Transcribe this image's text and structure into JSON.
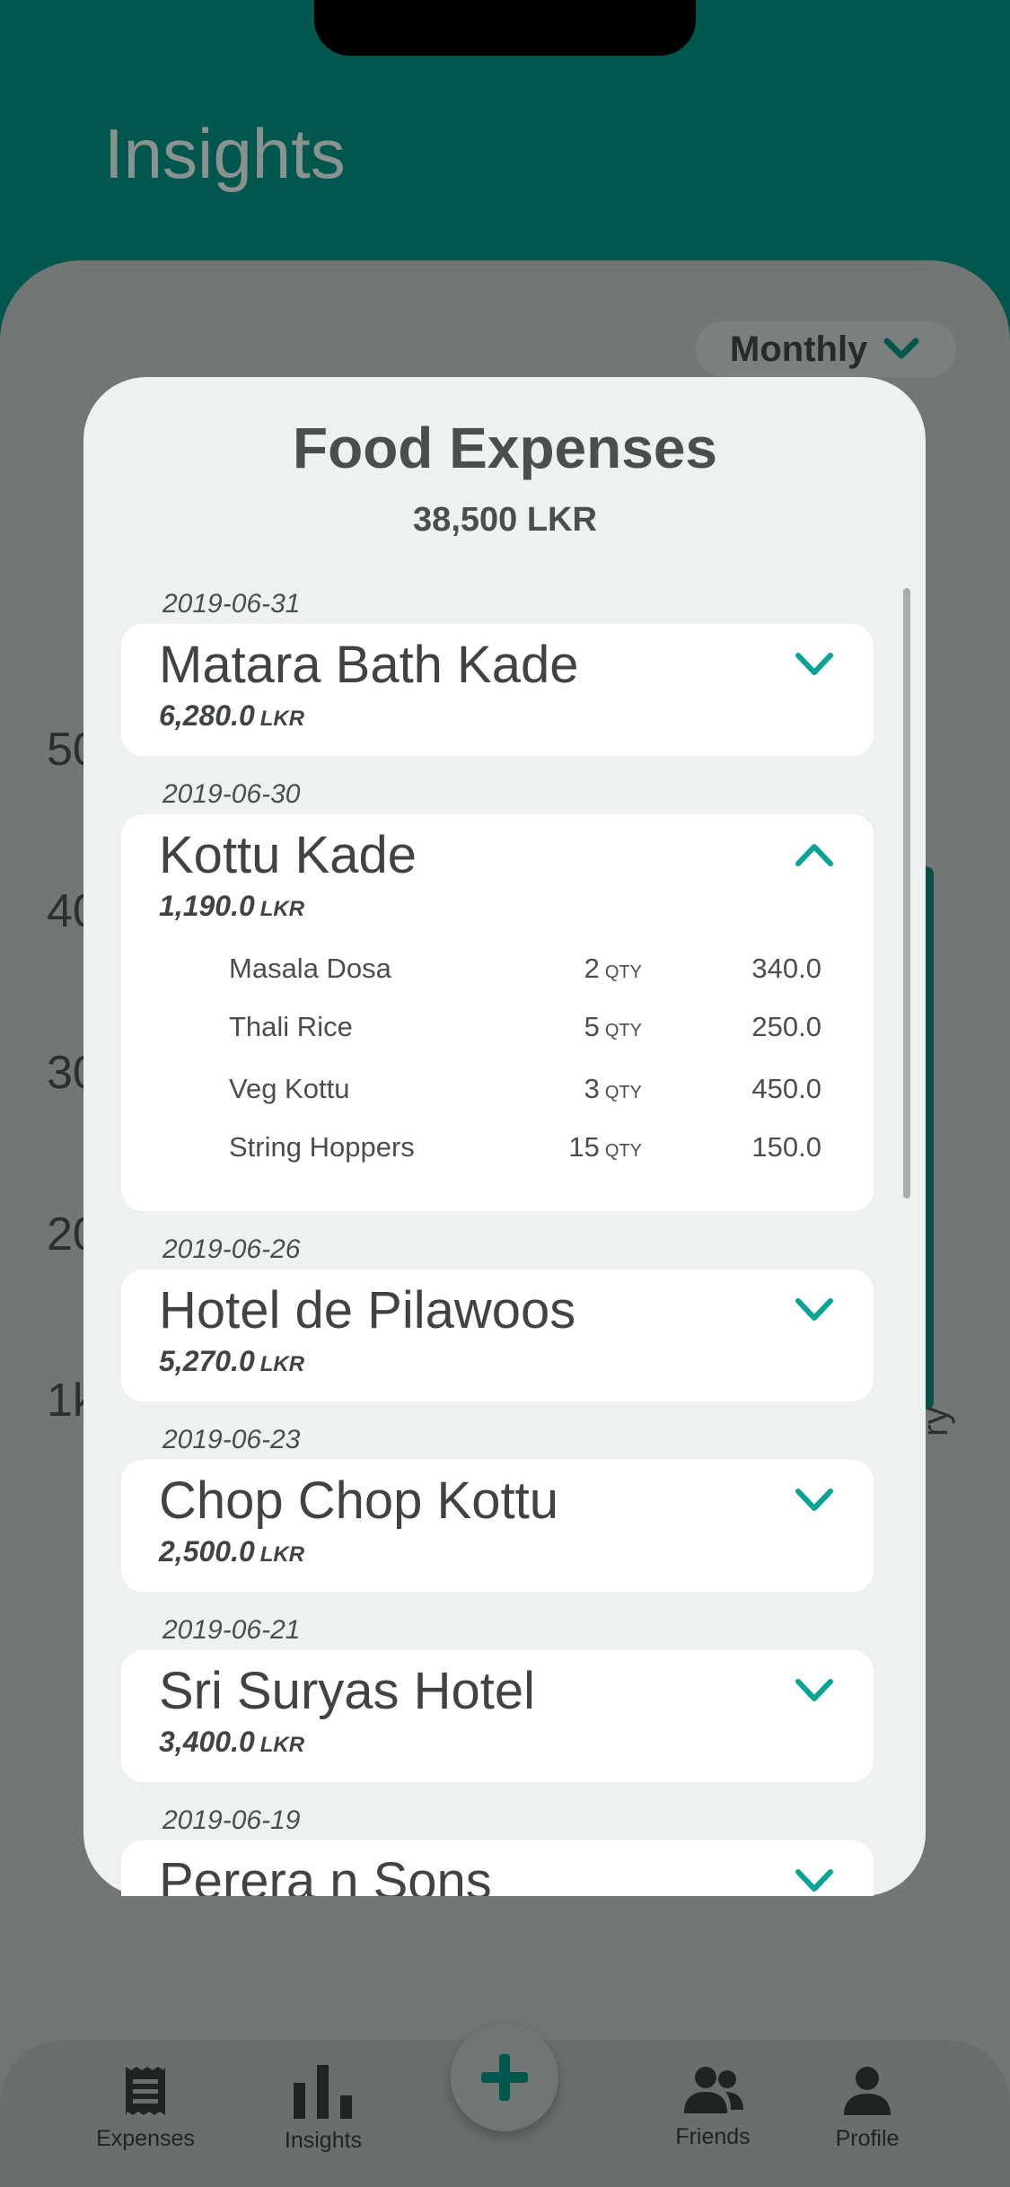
{
  "header": {
    "title": "Insights"
  },
  "period_select": {
    "value": "Monthly"
  },
  "background_chart": {
    "y_ticks": [
      "50",
      "40",
      "30",
      "20",
      "1k"
    ],
    "bar_label": "ry"
  },
  "modal": {
    "title": "Food Expenses",
    "total": "38,500 LKR",
    "entries": [
      {
        "date": "2019-06-31",
        "name": "Matara Bath Kade",
        "amount": "6,280.0",
        "currency": "LKR",
        "expanded": false
      },
      {
        "date": "2019-06-30",
        "name": "Kottu Kade",
        "amount": "1,190.0",
        "currency": "LKR",
        "expanded": true,
        "items": [
          {
            "name": "Masala Dosa",
            "qty": "2",
            "unit": "QTY",
            "price": "340.0"
          },
          {
            "name": "Thali Rice",
            "qty": "5",
            "unit": "QTY",
            "price": "250.0"
          },
          {
            "name": "Veg Kottu",
            "qty": "3",
            "unit": "QTY",
            "price": "450.0"
          },
          {
            "name": "String Hoppers",
            "qty": "15",
            "unit": "QTY",
            "price": "150.0"
          }
        ]
      },
      {
        "date": "2019-06-26",
        "name": "Hotel de Pilawoos",
        "amount": "5,270.0",
        "currency": "LKR",
        "expanded": false
      },
      {
        "date": "2019-06-23",
        "name": "Chop Chop Kottu",
        "amount": "2,500.0",
        "currency": "LKR",
        "expanded": false
      },
      {
        "date": "2019-06-21",
        "name": "Sri Suryas Hotel",
        "amount": "3,400.0",
        "currency": "LKR",
        "expanded": false
      },
      {
        "date": "2019-06-19",
        "name": "Perera n Sons",
        "amount": "",
        "currency": "",
        "expanded": false
      }
    ]
  },
  "bottom_nav": {
    "items": [
      {
        "label": "Expenses",
        "icon": "receipt-icon"
      },
      {
        "label": "Insights",
        "icon": "bar-chart-icon"
      },
      {
        "label": "Friends",
        "icon": "people-icon"
      },
      {
        "label": "Profile",
        "icon": "person-icon"
      }
    ],
    "fab_icon": "plus-icon"
  },
  "colors": {
    "header": "#00574e",
    "accent": "#0aa396",
    "modal_bg": "#edf1f0",
    "card_bg": "#ffffff",
    "dim_overlay": "#727776"
  }
}
